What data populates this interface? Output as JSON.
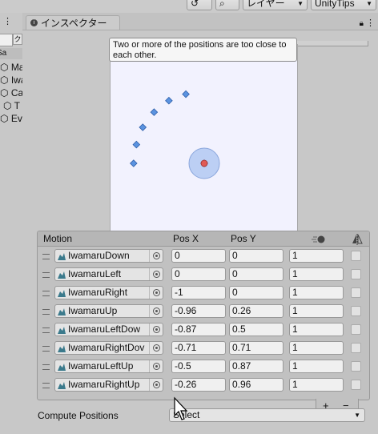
{
  "toolbar": {
    "layer_select": "レイヤー",
    "layout_select": "UnityTips"
  },
  "hierarchy": {
    "scene_label": "Sa",
    "items": [
      "Mai",
      "Iwa",
      "Car",
      "T",
      "Eve"
    ]
  },
  "inspector": {
    "tab_title": "インスペクター"
  },
  "blend_tree": {
    "warning": "Two or more of the positions are too close to each other.",
    "points": [
      {
        "name": "IwamaruDown",
        "x": 0,
        "y": 0
      },
      {
        "name": "IwamaruLeft",
        "x": 0,
        "y": 0
      },
      {
        "name": "IwamaruRight",
        "x": -1,
        "y": 0
      },
      {
        "name": "IwamaruUp",
        "x": -0.96,
        "y": 0.26
      },
      {
        "name": "IwamaruLeftDown",
        "x": -0.87,
        "y": 0.5
      },
      {
        "name": "IwamaruRightDown",
        "x": -0.71,
        "y": 0.71
      },
      {
        "name": "IwamaruLeftUp",
        "x": -0.5,
        "y": 0.87
      },
      {
        "name": "IwamaruRightUp",
        "x": -0.26,
        "y": 0.96
      }
    ]
  },
  "motion_list": {
    "headers": {
      "motion": "Motion",
      "pos_x": "Pos X",
      "pos_y": "Pos Y"
    },
    "rows": [
      {
        "motion": "IwamaruDown",
        "pos_x": "0",
        "pos_y": "0",
        "speed": "1"
      },
      {
        "motion": "IwamaruLeft",
        "pos_x": "0",
        "pos_y": "0",
        "speed": "1"
      },
      {
        "motion": "IwamaruRight",
        "pos_x": "-1",
        "pos_y": "0",
        "speed": "1"
      },
      {
        "motion": "IwamaruUp",
        "pos_x": "-0.96",
        "pos_y": "0.26",
        "speed": "1"
      },
      {
        "motion": "IwamaruLeftDow",
        "pos_x": "-0.87",
        "pos_y": "0.5",
        "speed": "1"
      },
      {
        "motion": "IwamaruRightDov",
        "pos_x": "-0.71",
        "pos_y": "0.71",
        "speed": "1"
      },
      {
        "motion": "IwamaruLeftUp",
        "pos_x": "-0.5",
        "pos_y": "0.87",
        "speed": "1"
      },
      {
        "motion": "IwamaruRightUp",
        "pos_x": "-0.26",
        "pos_y": "0.96",
        "speed": "1"
      }
    ],
    "add_label": "+",
    "remove_label": "−"
  },
  "compute": {
    "label": "Compute Positions",
    "value": "Select"
  },
  "colors": {
    "point": "#5b93e0",
    "center": "#e05a55",
    "center_ring": "#a9c3f0"
  }
}
